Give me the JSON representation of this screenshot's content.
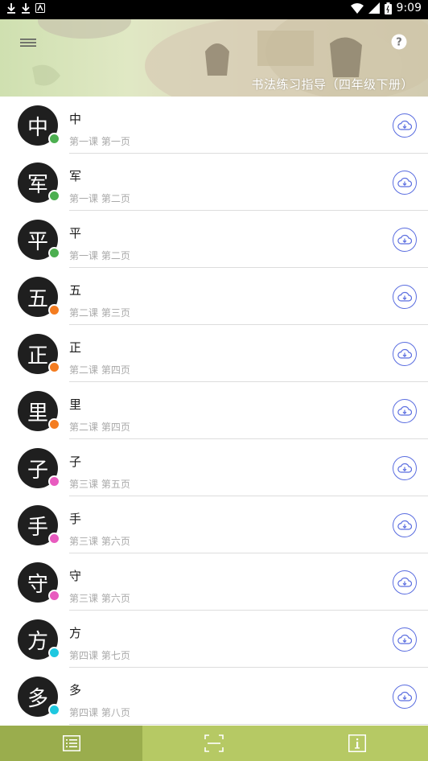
{
  "status_bar": {
    "time": "9:09"
  },
  "header": {
    "title": "书法练习指导（四年级下册）"
  },
  "colors": {
    "green": "#4caf50",
    "orange": "#f47c20",
    "pink": "#e85bbf",
    "cyan": "#1ec8e0"
  },
  "items": [
    {
      "char": "中",
      "sub": "第一课  第一页",
      "color": "green"
    },
    {
      "char": "军",
      "sub": "第一课  第二页",
      "color": "green"
    },
    {
      "char": "平",
      "sub": "第一课  第二页",
      "color": "green"
    },
    {
      "char": "五",
      "sub": "第二课  第三页",
      "color": "orange"
    },
    {
      "char": "正",
      "sub": "第二课  第四页",
      "color": "orange"
    },
    {
      "char": "里",
      "sub": "第二课  第四页",
      "color": "orange"
    },
    {
      "char": "子",
      "sub": "第三课  第五页",
      "color": "pink"
    },
    {
      "char": "手",
      "sub": "第三课  第六页",
      "color": "pink"
    },
    {
      "char": "守",
      "sub": "第三课  第六页",
      "color": "pink"
    },
    {
      "char": "方",
      "sub": "第四课  第七页",
      "color": "cyan"
    },
    {
      "char": "多",
      "sub": "第四课  第八页",
      "color": "cyan"
    }
  ],
  "bottom_nav": [
    {
      "icon": "list-icon",
      "active": true
    },
    {
      "icon": "scan-icon",
      "active": false
    },
    {
      "icon": "info-icon",
      "active": false
    }
  ]
}
